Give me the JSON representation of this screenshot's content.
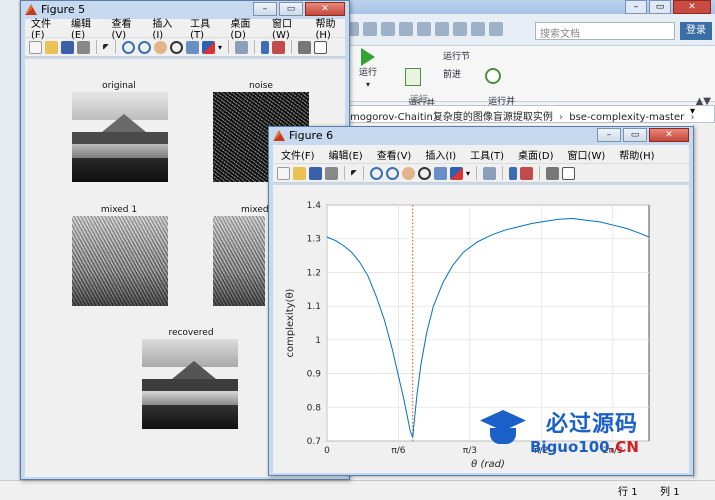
{
  "background": {
    "search_placeholder": "搜索文档",
    "login": "登录",
    "ribbon": {
      "run": "运行",
      "run_advance": "运行并\n前进",
      "run_section": "运行节",
      "advance": "前进",
      "run_and_time": "运行并\n计时",
      "section_label": "运行"
    },
    "address": {
      "part1": "mogorov-Chaitin复杂度的图像盲源提取实例",
      "part2": "bse-complexity-master"
    },
    "status": {
      "row": "行",
      "row_val": "1",
      "col": "列",
      "col_val": "1"
    }
  },
  "figure5": {
    "title": "Figure 5",
    "menu": [
      "文件(F)",
      "编辑(E)",
      "查看(V)",
      "插入(I)",
      "工具(T)",
      "桌面(D)",
      "窗口(W)",
      "帮助(H)"
    ],
    "subplots": {
      "original": "original",
      "noise": "noise",
      "mixed1": "mixed 1",
      "mixed2": "mixed",
      "recovered": "recovered"
    }
  },
  "figure6": {
    "title": "Figure 6",
    "menu": [
      "文件(F)",
      "编辑(E)",
      "查看(V)",
      "插入(I)",
      "工具(T)",
      "桌面(D)",
      "窗口(W)",
      "帮助(H)"
    ]
  },
  "watermark": {
    "cn": "必过源码",
    "en_a": "Biguo100",
    "en_b": ".CN"
  },
  "chart_data": {
    "type": "line",
    "xlabel": "θ (rad)",
    "ylabel": "complexity(θ)",
    "xlim": [
      0,
      1.5708
    ],
    "ylim": [
      0.7,
      1.4
    ],
    "xticks": [
      {
        "v": 0,
        "label": "0"
      },
      {
        "v": 0.5236,
        "label": "π/6"
      },
      {
        "v": 1.0472,
        "label": "π/3"
      },
      {
        "v": 1.5708,
        "label": "π/2"
      },
      {
        "v": 2.0944,
        "label": "2π/3"
      }
    ],
    "x_display_max": 2.36,
    "yticks": [
      0.7,
      0.8,
      0.9,
      1.0,
      1.1,
      1.2,
      1.3,
      1.4
    ],
    "grid": true,
    "vline": {
      "x": 0.628,
      "color": "#d95319",
      "style": "dotted"
    },
    "series": [
      {
        "color": "#0072bd",
        "x": [
          0,
          0.06,
          0.12,
          0.18,
          0.24,
          0.3,
          0.36,
          0.42,
          0.48,
          0.52,
          0.56,
          0.59,
          0.61,
          0.62,
          0.628,
          0.64,
          0.66,
          0.69,
          0.73,
          0.78,
          0.85,
          0.92,
          1.0,
          1.1,
          1.2,
          1.3,
          1.4,
          1.5,
          1.6,
          1.7,
          1.8,
          1.9,
          2.0,
          2.1,
          2.2,
          2.3,
          2.36
        ],
        "y": [
          1.305,
          1.295,
          1.28,
          1.26,
          1.23,
          1.19,
          1.13,
          1.06,
          0.97,
          0.9,
          0.83,
          0.77,
          0.73,
          0.72,
          0.71,
          0.76,
          0.84,
          0.93,
          1.02,
          1.1,
          1.17,
          1.22,
          1.26,
          1.29,
          1.31,
          1.325,
          1.335,
          1.345,
          1.352,
          1.358,
          1.36,
          1.355,
          1.35,
          1.34,
          1.33,
          1.315,
          1.305
        ]
      }
    ]
  }
}
